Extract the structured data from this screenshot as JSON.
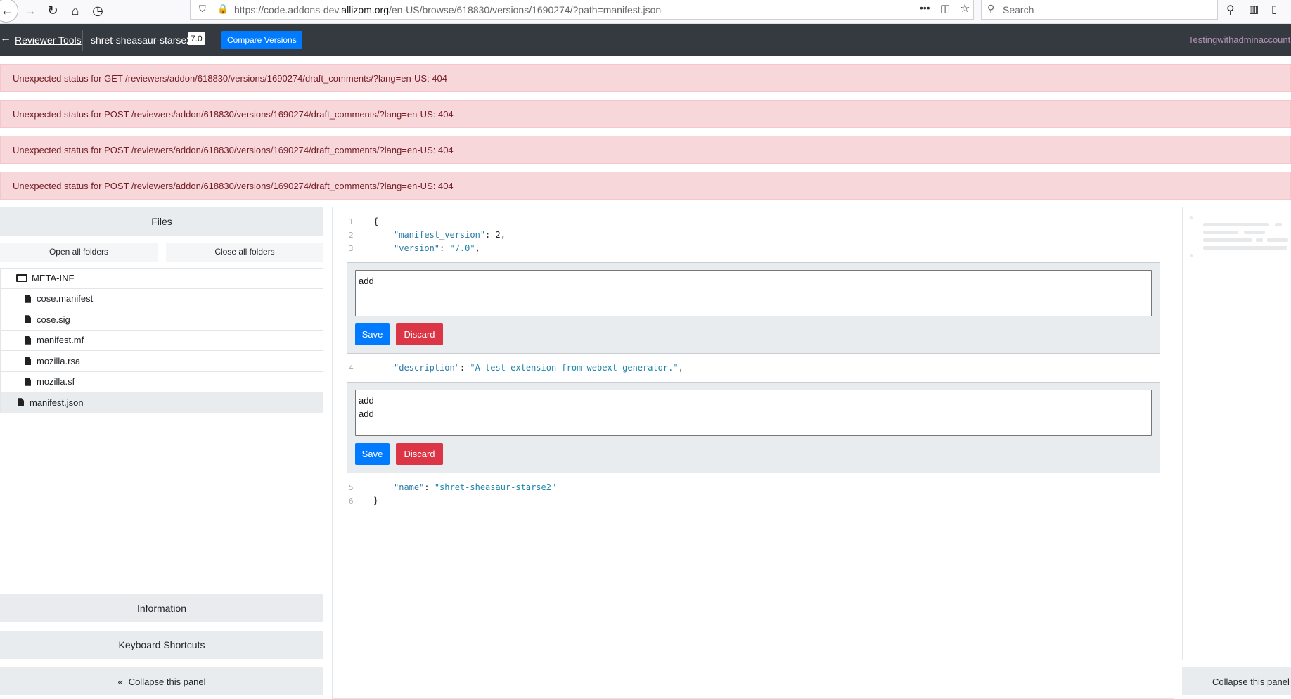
{
  "browser": {
    "url_prefix": "https://code.addons-dev.",
    "url_domain": "allizom.org",
    "url_suffix": "/en-US/browse/618830/versions/1690274/?path=manifest.json",
    "search_placeholder": "Search",
    "more_icon": "•••"
  },
  "header": {
    "reviewer_tools": "Reviewer Tools",
    "addon_name": "shret-sheasaur-starse2",
    "version": "7.0",
    "compare_label": "Compare Versions",
    "user": "Testingwithadminaccount"
  },
  "alerts": [
    "Unexpected status for GET /reviewers/addon/618830/versions/1690274/draft_comments/?lang=en-US: 404",
    "Unexpected status for POST /reviewers/addon/618830/versions/1690274/draft_comments/?lang=en-US: 404",
    "Unexpected status for POST /reviewers/addon/618830/versions/1690274/draft_comments/?lang=en-US: 404",
    "Unexpected status for POST /reviewers/addon/618830/versions/1690274/draft_comments/?lang=en-US: 404"
  ],
  "sidebar": {
    "files_heading": "Files",
    "open_all": "Open all folders",
    "close_all": "Close all folders",
    "tree": [
      {
        "label": "META-INF",
        "type": "folder"
      },
      {
        "label": "cose.manifest",
        "type": "file"
      },
      {
        "label": "cose.sig",
        "type": "file"
      },
      {
        "label": "manifest.mf",
        "type": "file"
      },
      {
        "label": "mozilla.rsa",
        "type": "file"
      },
      {
        "label": "mozilla.sf",
        "type": "file"
      },
      {
        "label": "manifest.json",
        "type": "file",
        "selected": true
      }
    ],
    "information": "Information",
    "keyboard_shortcuts": "Keyboard Shortcuts",
    "collapse": "Collapse this panel"
  },
  "code": {
    "lines": [
      {
        "n": "1",
        "text": "{"
      },
      {
        "n": "2",
        "key": "\"manifest_version\"",
        "rest": ": 2,"
      },
      {
        "n": "3",
        "key": "\"version\"",
        "sep": ": ",
        "val": "\"7.0\"",
        "rest": ","
      },
      {
        "n": "4",
        "key": "\"description\"",
        "sep": ": ",
        "val": "\"A test extension from webext-generator.\"",
        "rest": ","
      },
      {
        "n": "5",
        "key": "\"name\"",
        "sep": ": ",
        "val": "\"shret-sheasaur-starse2\"",
        "rest": ""
      },
      {
        "n": "6",
        "text": "}"
      }
    ],
    "comments": [
      {
        "text": "add",
        "save": "Save",
        "discard": "Discard"
      },
      {
        "text": "add\nadd",
        "save": "Save",
        "discard": "Discard"
      }
    ]
  },
  "right_panel": {
    "collapse": "Collapse this panel"
  }
}
